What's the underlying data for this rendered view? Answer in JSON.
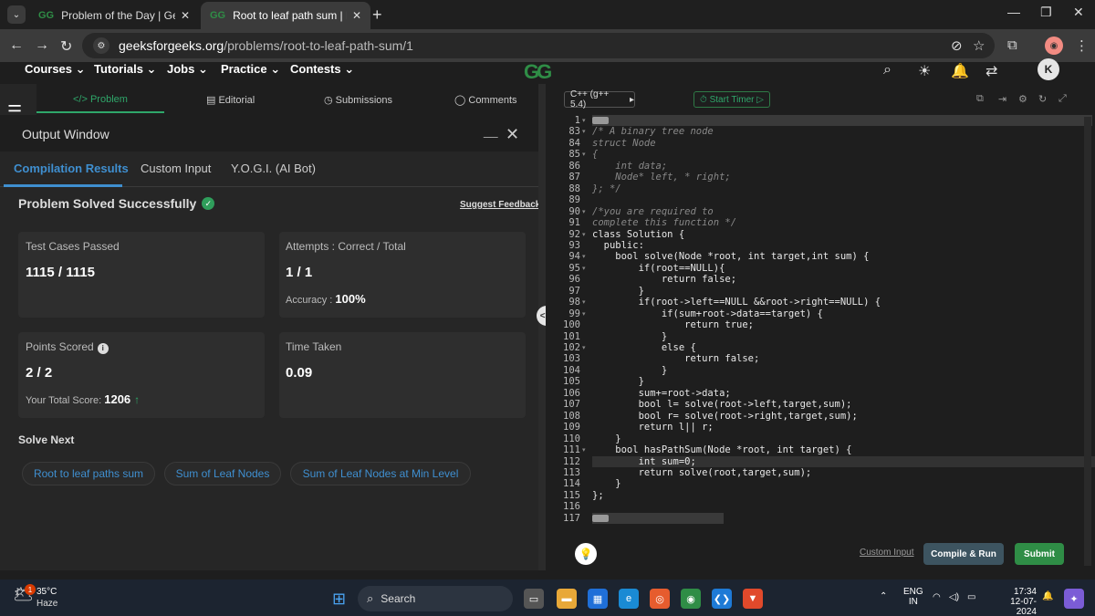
{
  "browser": {
    "tabs": [
      {
        "title": "Problem of the Day | GeeksforG",
        "favicon": "gfg-icon"
      },
      {
        "title": "Root to leaf path sum | Practice",
        "favicon": "gfg-icon"
      }
    ],
    "url_host": "geeksforgeeks.org",
    "url_path": "/problems/root-to-leaf-path-sum/1",
    "profile_avatar": "avatar-icon"
  },
  "site": {
    "menu": [
      "Courses",
      "Tutorials",
      "Jobs",
      "Practice",
      "Contests"
    ],
    "logo": "GG",
    "user_initial": "K"
  },
  "problem_tabs": [
    "</> Problem",
    "Editorial",
    "Submissions",
    "Comments"
  ],
  "output": {
    "title": "Output Window",
    "tabs": [
      "Compilation Results",
      "Custom Input",
      "Y.O.G.I. (AI Bot)"
    ],
    "status": "Problem Solved Successfully",
    "feedback": "Suggest Feedback",
    "test_cases_label": "Test Cases Passed",
    "test_cases_value": "1115 / 1115",
    "attempts_label": "Attempts : Correct / Total",
    "attempts_value": "1 / 1",
    "accuracy_label": "Accuracy :",
    "accuracy_value": "100%",
    "points_label": "Points Scored",
    "points_value": "2 / 2",
    "total_score_label": "Your Total Score:",
    "total_score_value": "1206",
    "time_label": "Time Taken",
    "time_value": "0.09",
    "solve_next": "Solve Next",
    "next_problems": [
      "Root to leaf paths sum",
      "Sum of Leaf Nodes",
      "Sum of Leaf Nodes at Min Level"
    ]
  },
  "editor": {
    "language": "C++ (g++ 5.4)",
    "timer": "Start Timer",
    "lines": [
      {
        "n": "1",
        "text": "",
        "type": "folded"
      },
      {
        "n": "83",
        "text": "/* A binary tree node",
        "type": "comment"
      },
      {
        "n": "84",
        "text": "struct Node",
        "type": "comment"
      },
      {
        "n": "85",
        "text": "{",
        "type": "comment"
      },
      {
        "n": "86",
        "text": "    int data;",
        "type": "comment"
      },
      {
        "n": "87",
        "text": "    Node* left, * right;",
        "type": "comment"
      },
      {
        "n": "88",
        "text": "}; */",
        "type": "comment"
      },
      {
        "n": "89",
        "text": "",
        "type": "code"
      },
      {
        "n": "90",
        "text": "/*you are required to",
        "type": "comment"
      },
      {
        "n": "91",
        "text": "complete this function */",
        "type": "comment"
      },
      {
        "n": "92",
        "text": "class Solution {",
        "type": "code"
      },
      {
        "n": "93",
        "text": "  public:",
        "type": "code"
      },
      {
        "n": "94",
        "text": "    bool solve(Node *root, int target,int sum) {",
        "type": "code"
      },
      {
        "n": "95",
        "text": "        if(root==NULL){",
        "type": "code"
      },
      {
        "n": "96",
        "text": "            return false;",
        "type": "code"
      },
      {
        "n": "97",
        "text": "        }",
        "type": "code"
      },
      {
        "n": "98",
        "text": "        if(root->left==NULL &&root->right==NULL) {",
        "type": "code"
      },
      {
        "n": "99",
        "text": "            if(sum+root->data==target) {",
        "type": "code"
      },
      {
        "n": "100",
        "text": "                return true;",
        "type": "code"
      },
      {
        "n": "101",
        "text": "            }",
        "type": "code"
      },
      {
        "n": "102",
        "text": "            else {",
        "type": "code"
      },
      {
        "n": "103",
        "text": "                return false;",
        "type": "code"
      },
      {
        "n": "104",
        "text": "            }",
        "type": "code"
      },
      {
        "n": "105",
        "text": "        }",
        "type": "code"
      },
      {
        "n": "106",
        "text": "        sum+=root->data;",
        "type": "code"
      },
      {
        "n": "107",
        "text": "        bool l= solve(root->left,target,sum);",
        "type": "code"
      },
      {
        "n": "108",
        "text": "        bool r= solve(root->right,target,sum);",
        "type": "code"
      },
      {
        "n": "109",
        "text": "        return l|| r;",
        "type": "code"
      },
      {
        "n": "110",
        "text": "    }",
        "type": "code"
      },
      {
        "n": "111",
        "text": "    bool hasPathSum(Node *root, int target) {",
        "type": "code"
      },
      {
        "n": "112",
        "text": "        int sum=0;",
        "type": "hl"
      },
      {
        "n": "113",
        "text": "        return solve(root,target,sum);",
        "type": "code"
      },
      {
        "n": "114",
        "text": "    }",
        "type": "code"
      },
      {
        "n": "115",
        "text": "};",
        "type": "code"
      },
      {
        "n": "116",
        "text": "",
        "type": "code"
      },
      {
        "n": "117",
        "text": "",
        "type": "folded"
      }
    ],
    "custom_input": "Custom Input",
    "compile_run": "Compile & Run",
    "submit": "Submit"
  },
  "taskbar": {
    "temp": "35°C",
    "condition": "Haze",
    "weather_badge": "1",
    "search": "Search",
    "lang1": "ENG",
    "lang2": "IN",
    "time": "17:34",
    "date": "12-07-2024"
  },
  "colors": {
    "accent_green": "#2f8d46",
    "accent_blue": "#3f8fd0"
  }
}
